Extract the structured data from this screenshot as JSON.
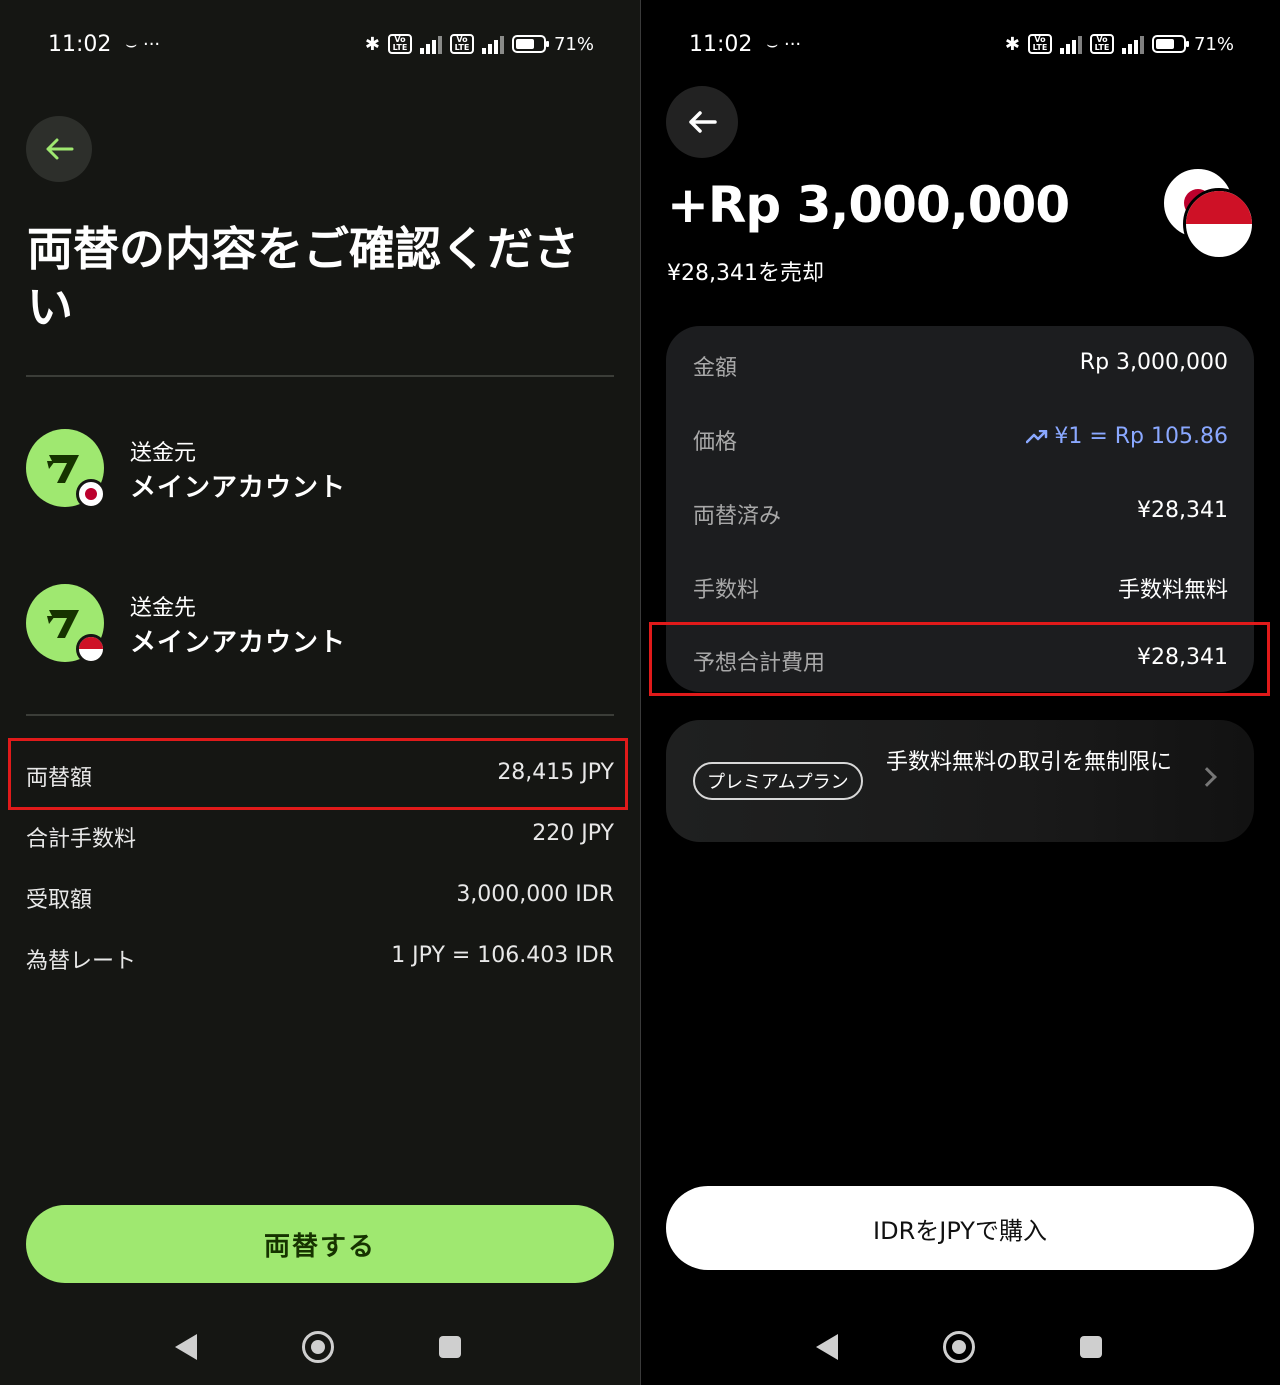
{
  "left": {
    "status": {
      "time": "11:02",
      "extra": "⌣ ···",
      "battery": "71%",
      "battery_level": 0.71
    },
    "title": "両替の内容をご確認ください",
    "source": {
      "label": "送金元",
      "name": "メインアカウント"
    },
    "dest": {
      "label": "送金先",
      "name": "メインアカウント"
    },
    "rows": [
      {
        "k": "両替額",
        "v": "28,415 JPY"
      },
      {
        "k": "合計手数料",
        "v": "220 JPY"
      },
      {
        "k": "受取額",
        "v": "3,000,000 IDR"
      },
      {
        "k": "為替レート",
        "v": "1 JPY = 106.403 IDR"
      }
    ],
    "button": "両替する"
  },
  "right": {
    "status": {
      "time": "11:02",
      "extra": "⌣ ···",
      "battery": "71%",
      "battery_level": 0.71
    },
    "amount": "+Rp 3,000,000",
    "sub": "¥28,341を売却",
    "rows": [
      {
        "k": "金額",
        "v": "Rp 3,000,000"
      },
      {
        "k": "価格",
        "v": "¥1 = Rp 105.86"
      },
      {
        "k": "両替済み",
        "v": "¥28,341"
      },
      {
        "k": "手数料",
        "v": "手数料無料"
      },
      {
        "k": "予想合計費用",
        "v": "¥28,341"
      }
    ],
    "promo": {
      "pill": "プレミアムプラン",
      "text": "手数料無料の取引を無制限に"
    },
    "button": "IDRをJPYで購入"
  },
  "colors": {
    "accent_green": "#9fe870",
    "highlight_red": "#e01a1a",
    "rate_blue": "#8aa8ff"
  }
}
